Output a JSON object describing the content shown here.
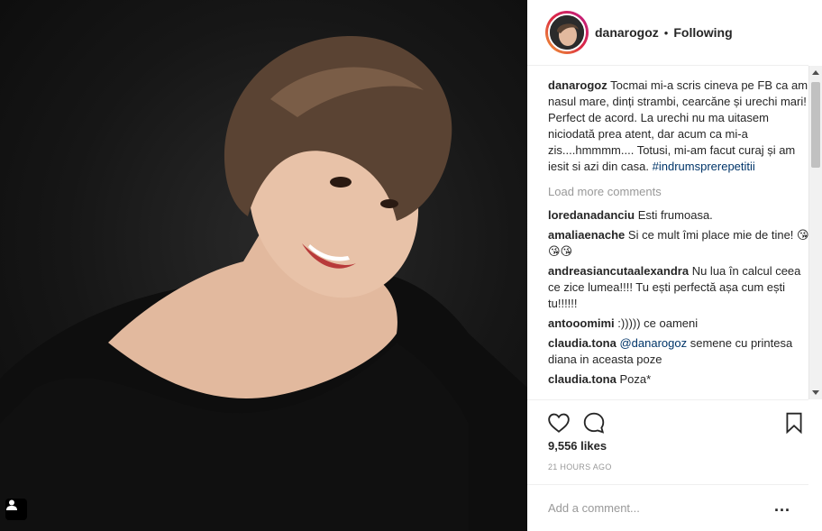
{
  "post": {
    "image_alt": "Photo by danarogoz",
    "username": "danarogoz",
    "separator": "•",
    "follow_status": "Following",
    "caption": {
      "username": "danarogoz",
      "text": "Tocmai mi-a scris cineva pe FB ca am nasul mare, dinți strambi, cearcăne și urechi mari! Perfect de acord. La urechi nu ma uitasem niciodată prea atent, dar acum ca mi-a zis....hmmmm.... Totusi, mi-am facut curaj și am iesit si azi din casa.",
      "hashtag": "#indrumsprerepetitii"
    },
    "load_more_label": "Load more comments",
    "comments": [
      {
        "username": "loredanadanciu",
        "text": "Esti frumoasa."
      },
      {
        "username": "amaliaenache",
        "text": "Si ce mult îmi place mie de tine! 😘😘😘"
      },
      {
        "username": "andreasiancutaalexandra",
        "text": "Nu lua în calcul ceea ce zice lumea!!!! Tu ești perfectă așa cum ești tu!!!!!!"
      },
      {
        "username": "antooomimi",
        "text": ":))))) ce oameni"
      },
      {
        "username": "claudia.tona",
        "mention": "@danarogoz",
        "text": " semene cu printesa diana in aceasta poze"
      },
      {
        "username": "claudia.tona",
        "text": "Poza*"
      }
    ],
    "likes": "9,556 likes",
    "time": "21 HOURS AGO",
    "add_comment_placeholder": "Add a comment...",
    "more_options": "..."
  },
  "icons": {
    "like": "heart-icon",
    "comment": "comment-bubble-icon",
    "save": "bookmark-icon",
    "tag": "user-tag-icon",
    "more": "more-options-icon"
  },
  "colors": {
    "link": "#003569",
    "muted": "#999999",
    "text": "#262626",
    "border": "#efefef"
  }
}
